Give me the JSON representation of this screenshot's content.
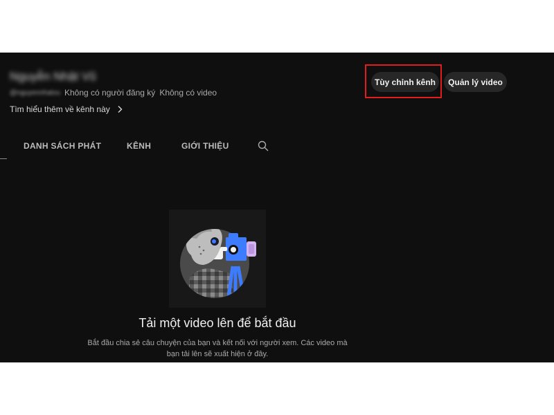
{
  "channel": {
    "name": "Nguyễn Nhật Vũ",
    "handle": "@nguyennhatvu",
    "subscribers": "Không có người đăng ký",
    "videos": "Không có video",
    "learn_more": "Tìm hiểu thêm về kênh này"
  },
  "actions": {
    "customize_label": "Tùy chỉnh kênh",
    "manage_label": "Quản lý video"
  },
  "tabs": [
    {
      "label": "DANH SÁCH PHÁT"
    },
    {
      "label": "KÊNH"
    },
    {
      "label": "GIỚI THIỆU"
    }
  ],
  "empty_state": {
    "title": "Tải một video lên để bắt đầu",
    "description": "Bắt đầu chia sẻ câu chuyện của bạn và kết nối với người xem. Các video mà bạn tải lên sẽ xuất hiện ở đây."
  },
  "icons": {
    "search": "search-icon",
    "chevron": "chevron-right-icon",
    "illustration": "camera-operator-illustration"
  },
  "colors": {
    "background": "#0f0f0f",
    "button": "#272727",
    "highlight": "#e01e1e",
    "accent_blue": "#3d7cff"
  }
}
